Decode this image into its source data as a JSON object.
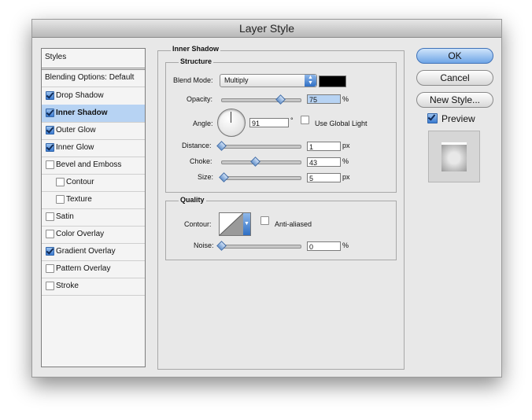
{
  "window": {
    "title": "Layer Style"
  },
  "sidebar": {
    "items": [
      {
        "label": "Styles",
        "checked": null,
        "selected": false
      },
      {
        "label": "Blending Options: Default",
        "checked": null,
        "selected": false
      },
      {
        "label": "Drop Shadow",
        "checked": true,
        "selected": false
      },
      {
        "label": "Inner Shadow",
        "checked": true,
        "selected": true
      },
      {
        "label": "Outer Glow",
        "checked": true,
        "selected": false
      },
      {
        "label": "Inner Glow",
        "checked": true,
        "selected": false
      },
      {
        "label": "Bevel and Emboss",
        "checked": false,
        "selected": false
      },
      {
        "label": "Contour",
        "checked": false,
        "selected": false
      },
      {
        "label": "Texture",
        "checked": false,
        "selected": false
      },
      {
        "label": "Satin",
        "checked": false,
        "selected": false
      },
      {
        "label": "Color Overlay",
        "checked": false,
        "selected": false
      },
      {
        "label": "Gradient Overlay",
        "checked": true,
        "selected": false
      },
      {
        "label": "Pattern Overlay",
        "checked": false,
        "selected": false
      },
      {
        "label": "Stroke",
        "checked": false,
        "selected": false
      }
    ]
  },
  "panel": {
    "title": "Inner Shadow",
    "structure": {
      "title": "Structure",
      "blend_mode_label": "Blend Mode:",
      "blend_mode_value": "Multiply",
      "blend_color": "#000000",
      "opacity_label": "Opacity:",
      "opacity_value": "75",
      "opacity_unit": "%",
      "opacity_level": 0.75,
      "angle_label": "Angle:",
      "angle_value": "91",
      "angle_unit": "°",
      "use_global_light_label": "Use Global Light",
      "use_global_light": false,
      "distance_label": "Distance:",
      "distance_value": "1",
      "distance_unit": "px",
      "distance_level": 0.0,
      "choke_label": "Choke:",
      "choke_value": "43",
      "choke_unit": "%",
      "choke_level": 0.43,
      "size_label": "Size:",
      "size_value": "5",
      "size_unit": "px",
      "size_level": 0.03
    },
    "quality": {
      "title": "Quality",
      "contour_label": "Contour:",
      "anti_aliased_label": "Anti-aliased",
      "anti_aliased": false,
      "noise_label": "Noise:",
      "noise_value": "0",
      "noise_unit": "%",
      "noise_level": 0.0
    }
  },
  "buttons": {
    "ok": "OK",
    "cancel": "Cancel",
    "new_style": "New Style..."
  },
  "preview": {
    "label": "Preview",
    "checked": true
  },
  "colors": {
    "accent": "#6fa5e6",
    "selection": "#b7d3f3"
  }
}
